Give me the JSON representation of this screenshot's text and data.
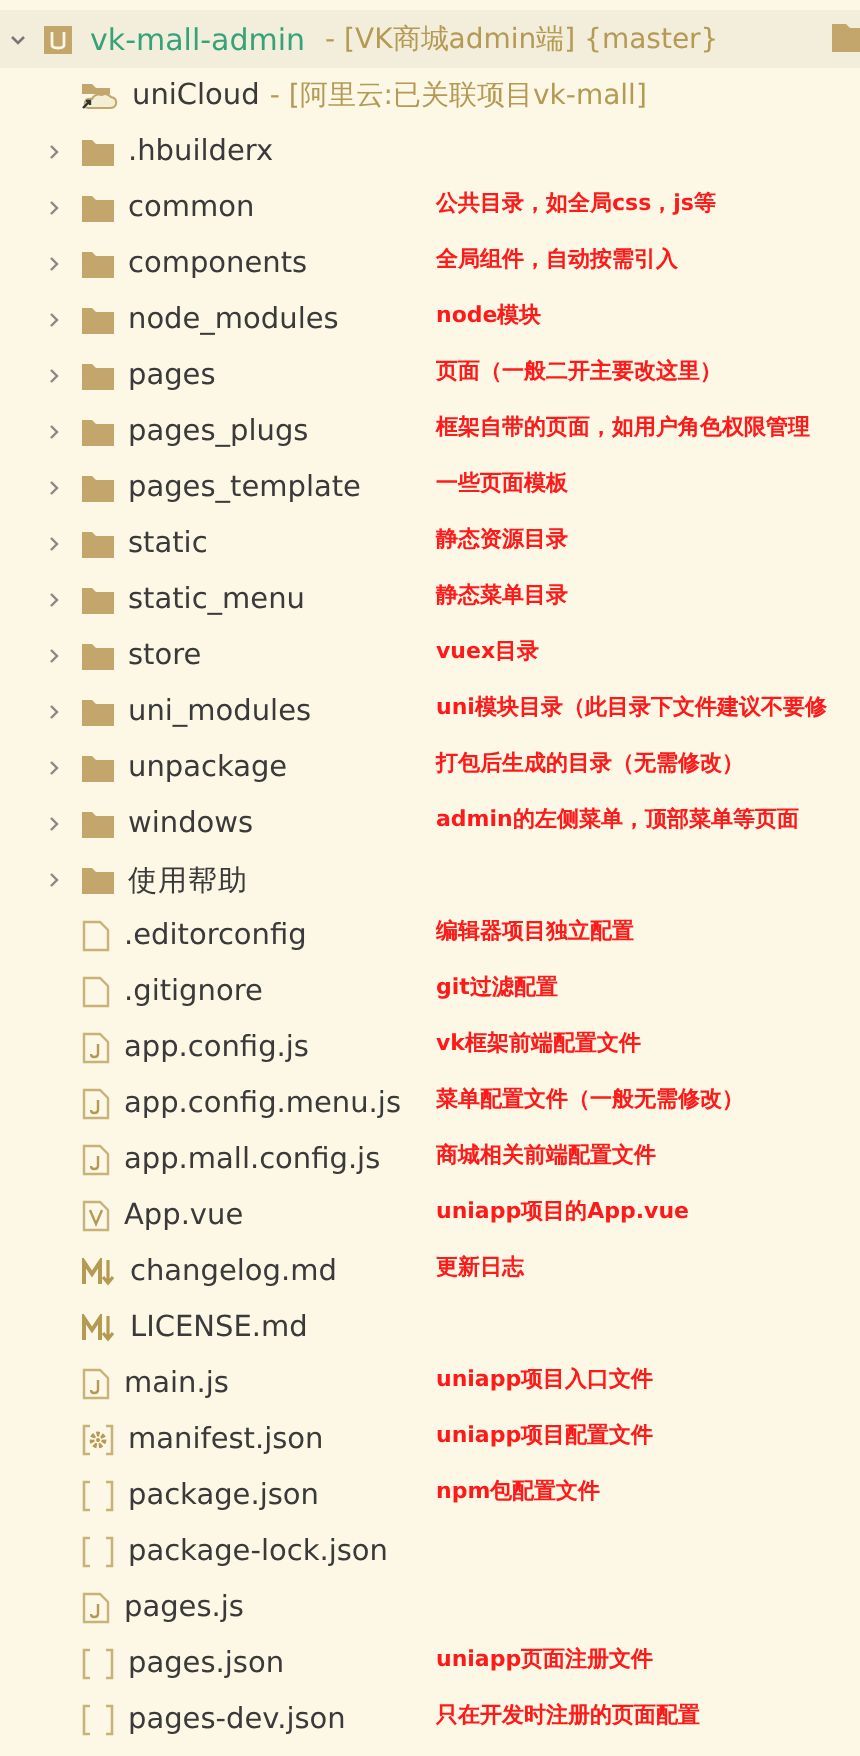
{
  "root": {
    "name": "vk-mall-admin",
    "suffix": "- [VK商城admin端] {master}",
    "expanded": true,
    "children": [
      {
        "kind": "cloud",
        "name": "uniCloud",
        "suffix": "- [阿里云:已关联项目vk-mall]"
      },
      {
        "kind": "folder",
        "name": ".hbuilderx",
        "expanded": false
      },
      {
        "kind": "folder",
        "name": "common",
        "expanded": false,
        "note": "公共目录，如全局css，js等"
      },
      {
        "kind": "folder",
        "name": "components",
        "expanded": false,
        "note": "全局组件，自动按需引入"
      },
      {
        "kind": "folder",
        "name": "node_modules",
        "expanded": false,
        "note": "node模块"
      },
      {
        "kind": "folder",
        "name": "pages",
        "expanded": false,
        "note": "页面（一般二开主要改这里）"
      },
      {
        "kind": "folder",
        "name": "pages_plugs",
        "expanded": false,
        "note": "框架自带的页面，如用户角色权限管理"
      },
      {
        "kind": "folder",
        "name": "pages_template",
        "expanded": false,
        "note": "一些页面模板"
      },
      {
        "kind": "folder",
        "name": "static",
        "expanded": false,
        "note": "静态资源目录"
      },
      {
        "kind": "folder",
        "name": "static_menu",
        "expanded": false,
        "note": "静态菜单目录"
      },
      {
        "kind": "folder",
        "name": "store",
        "expanded": false,
        "note": "vuex目录"
      },
      {
        "kind": "folder",
        "name": "uni_modules",
        "expanded": false,
        "note": "uni模块目录（此目录下文件建议不要修"
      },
      {
        "kind": "folder",
        "name": "unpackage",
        "expanded": false,
        "note": "打包后生成的目录（无需修改）"
      },
      {
        "kind": "folder",
        "name": "windows",
        "expanded": false,
        "note": "admin的左侧菜单，顶部菜单等页面"
      },
      {
        "kind": "folder",
        "name": "使用帮助",
        "expanded": false
      },
      {
        "kind": "file",
        "name": ".editorconfig",
        "note": "编辑器项目独立配置"
      },
      {
        "kind": "file",
        "name": ".gitignore",
        "note": "git过滤配置"
      },
      {
        "kind": "js",
        "name": "app.config.js",
        "note": "vk框架前端配置文件"
      },
      {
        "kind": "js",
        "name": "app.config.menu.js",
        "note": "菜单配置文件（一般无需修改）"
      },
      {
        "kind": "js",
        "name": "app.mall.config.js",
        "note": "商城相关前端配置文件"
      },
      {
        "kind": "vue",
        "name": "App.vue",
        "note": "uniapp项目的App.vue"
      },
      {
        "kind": "md",
        "name": "changelog.md",
        "note": "更新日志"
      },
      {
        "kind": "md",
        "name": "LICENSE.md"
      },
      {
        "kind": "js",
        "name": "main.js",
        "note": "uniapp项目入口文件"
      },
      {
        "kind": "settings-json",
        "name": "manifest.json",
        "note": "uniapp项目配置文件"
      },
      {
        "kind": "json",
        "name": "package.json",
        "note": "npm包配置文件"
      },
      {
        "kind": "json",
        "name": "package-lock.json"
      },
      {
        "kind": "js",
        "name": "pages.js"
      },
      {
        "kind": "json",
        "name": "pages.json",
        "note": "uniapp页面注册文件"
      },
      {
        "kind": "json",
        "name": "pages-dev.json",
        "note": "只在开发时注册的页面配置"
      }
    ]
  }
}
